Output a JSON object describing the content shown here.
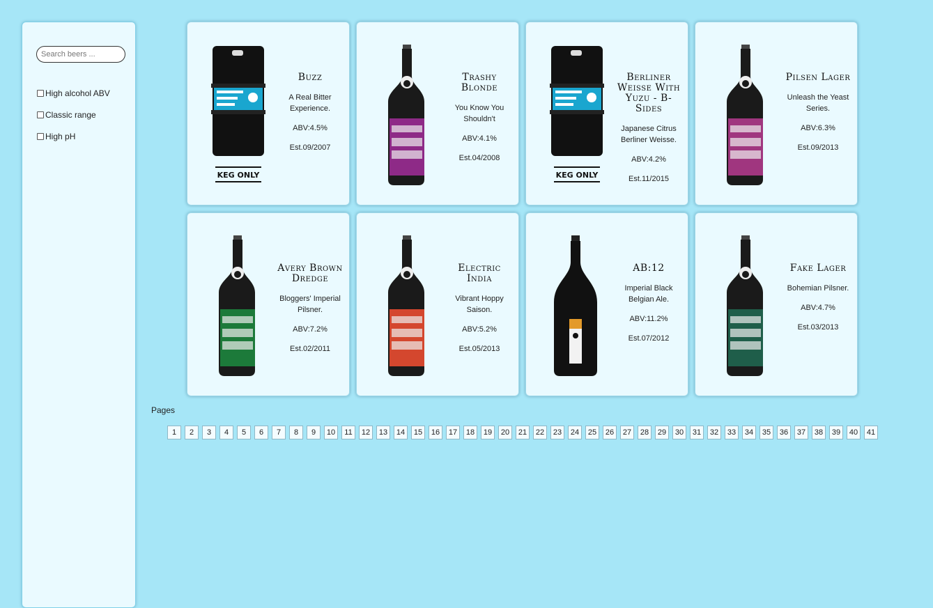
{
  "sidebar": {
    "search_placeholder": "Search beers ...",
    "filters": [
      "High alcohol ABV",
      "Classic range",
      "High pH"
    ]
  },
  "beers": [
    {
      "name": "Buzz",
      "tagline": "A Real Bitter Experience.",
      "abv": "ABV:4.5%",
      "est": "Est.09/2007",
      "image": "keg-only",
      "label_color": "#1aa6cf"
    },
    {
      "name": "Trashy Blonde",
      "tagline": "You Know You Shouldn't",
      "abv": "ABV:4.1%",
      "est": "Est.04/2008",
      "image": "bottle",
      "label_color": "#8e2a87"
    },
    {
      "name": "Berliner Weisse With Yuzu - B-Sides",
      "tagline": "Japanese Citrus Berliner Weisse.",
      "abv": "ABV:4.2%",
      "est": "Est.11/2015",
      "image": "keg-only",
      "label_color": "#1aa6cf"
    },
    {
      "name": "Pilsen Lager",
      "tagline": "Unleash the Yeast Series.",
      "abv": "ABV:6.3%",
      "est": "Est.09/2013",
      "image": "bottle",
      "label_color": "#a0367f"
    },
    {
      "name": "Avery Brown Dredge",
      "tagline": "Bloggers' Imperial Pilsner.",
      "abv": "ABV:7.2%",
      "est": "Est.02/2011",
      "image": "bottle",
      "label_color": "#1c7a3a"
    },
    {
      "name": "Electric India",
      "tagline": "Vibrant Hoppy Saison.",
      "abv": "ABV:5.2%",
      "est": "Est.05/2013",
      "image": "bottle",
      "label_color": "#d4472e"
    },
    {
      "name": "AB:12",
      "tagline": "Imperial Black Belgian Ale.",
      "abv": "ABV:11.2%",
      "est": "Est.07/2012",
      "image": "champagne-bottle",
      "label_color": "#e39a2a"
    },
    {
      "name": "Fake Lager",
      "tagline": "Bohemian Pilsner.",
      "abv": "ABV:4.7%",
      "est": "Est.03/2013",
      "image": "bottle",
      "label_color": "#1f5e4a"
    }
  ],
  "pagination": {
    "label": "Pages",
    "pages": [
      "1",
      "2",
      "3",
      "4",
      "5",
      "6",
      "7",
      "8",
      "9",
      "10",
      "11",
      "12",
      "13",
      "14",
      "15",
      "16",
      "17",
      "18",
      "19",
      "20",
      "21",
      "22",
      "23",
      "24",
      "25",
      "26",
      "27",
      "28",
      "29",
      "30",
      "31",
      "32",
      "33",
      "34",
      "35",
      "36",
      "37",
      "38",
      "39",
      "40",
      "41"
    ]
  }
}
